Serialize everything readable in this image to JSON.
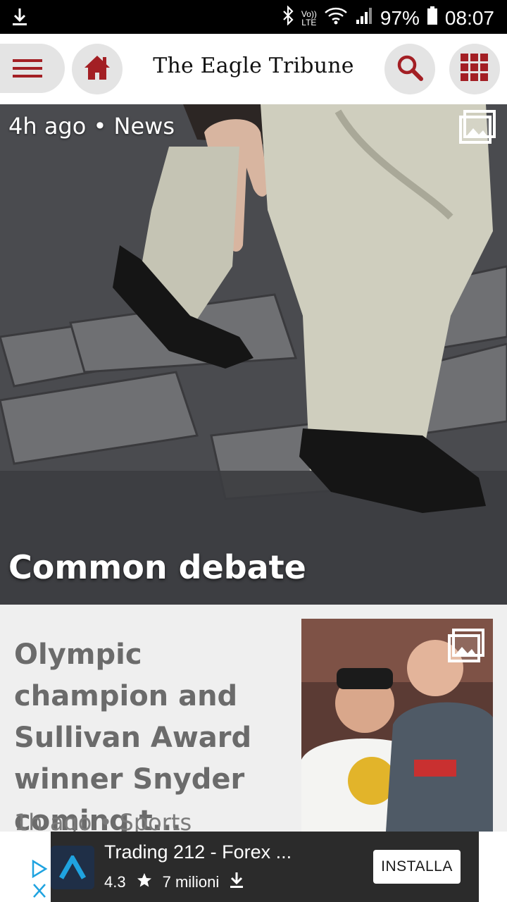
{
  "status_bar": {
    "lte_top": "Vo))",
    "lte_bottom": "LTE",
    "battery": "97%",
    "time": "08:07"
  },
  "header": {
    "brand": "The Eagle Tribune",
    "accent_color": "#a31f24"
  },
  "hero": {
    "meta": "4h ago • News",
    "title": "Common debate"
  },
  "story2": {
    "title": "Olympic champion and Sullivan Award winner Snyder coming t…",
    "meta": "1h ago • Sports"
  },
  "ad": {
    "title": "Trading 212 - Forex ...",
    "rating": "4.3",
    "downloads": "7 milioni",
    "install": "INSTALLA"
  },
  "icons": [
    "download-icon",
    "bluetooth-icon",
    "wifi-icon",
    "signal-icon",
    "battery-icon",
    "menu-icon",
    "home-icon",
    "search-icon",
    "grid-icon",
    "gallery-icon",
    "star-icon",
    "adchoices-icon",
    "close-icon"
  ]
}
